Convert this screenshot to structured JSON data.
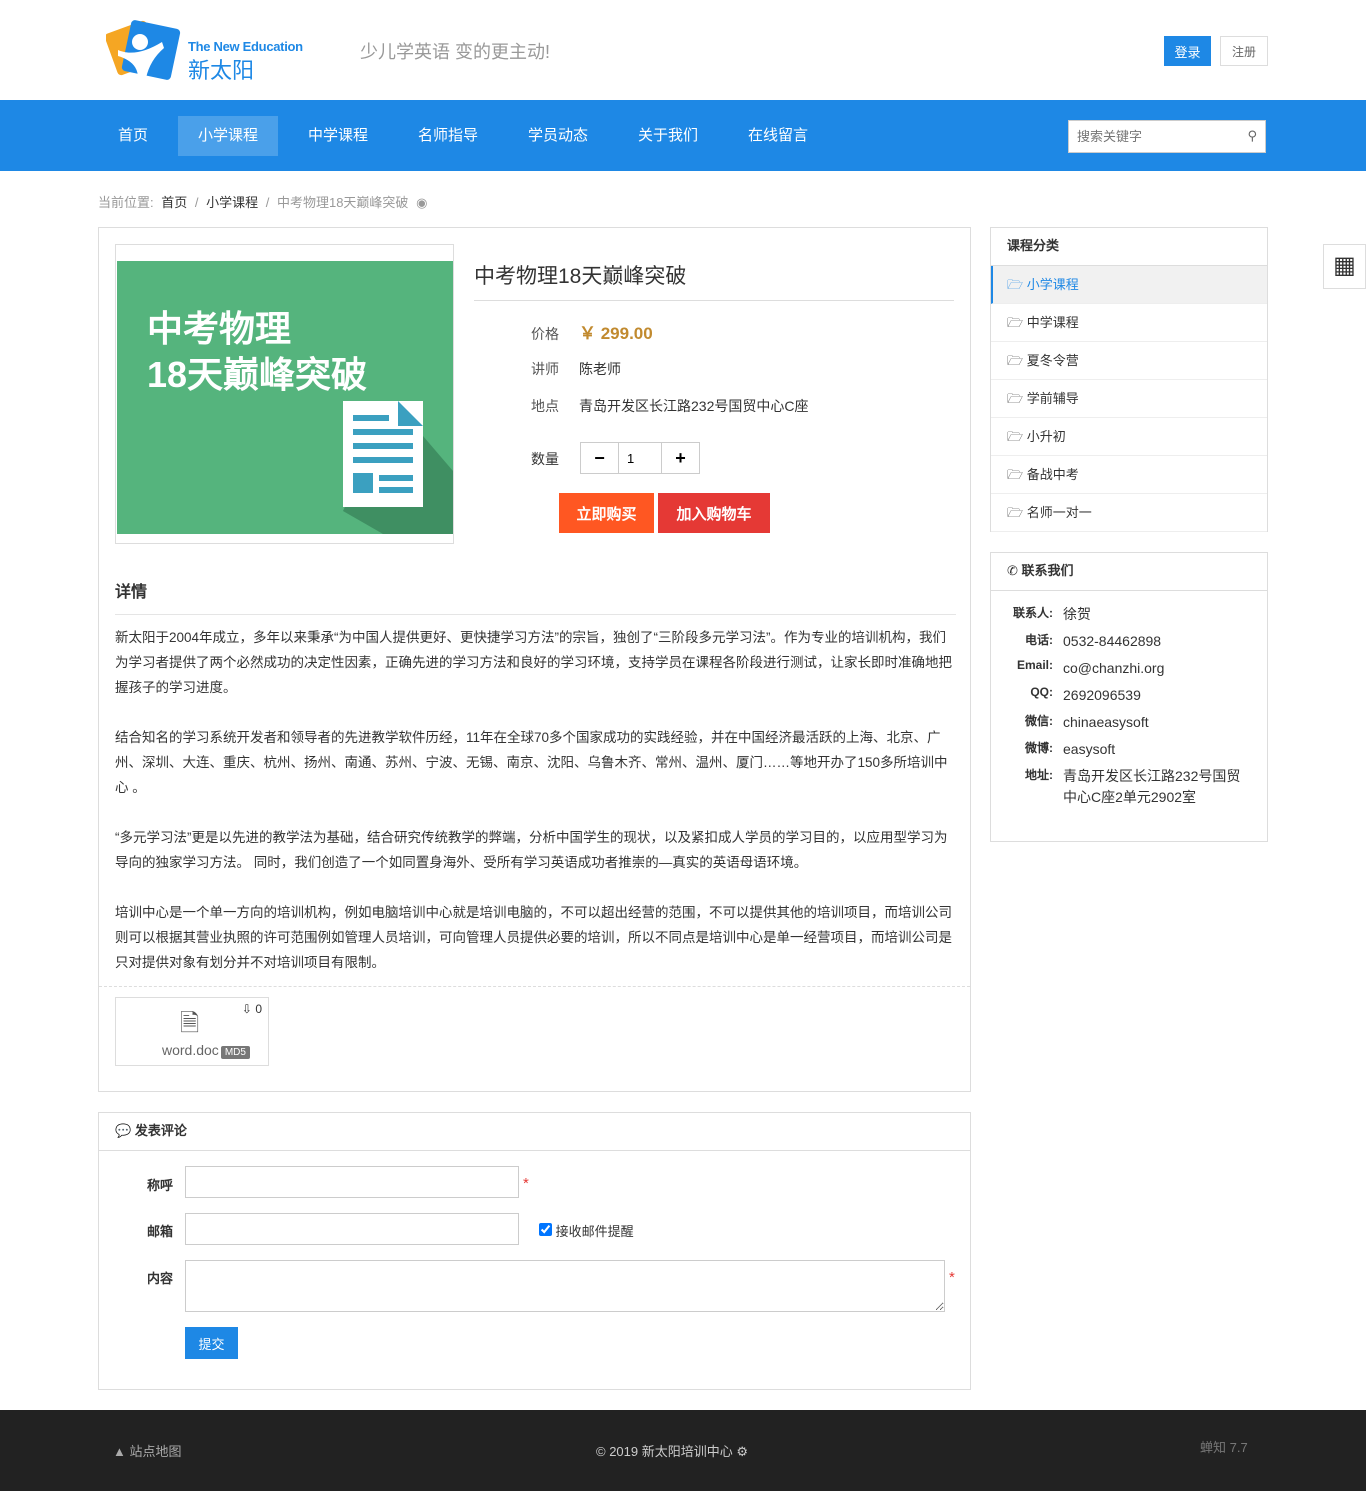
{
  "header": {
    "logo_en": "The New Education",
    "logo_cn": "新太阳",
    "slogan": "少儿学英语 变的更主动!",
    "login": "登录",
    "register": "注册"
  },
  "nav": {
    "items": [
      "首页",
      "小学课程",
      "中学课程",
      "名师指导",
      "学员动态",
      "关于我们",
      "在线留言"
    ],
    "active": 1,
    "search_placeholder": "搜索关键字"
  },
  "breadcrumb": {
    "label": "当前位置:",
    "items": [
      "首页",
      "小学课程",
      "中考物理18天巅峰突破"
    ]
  },
  "product": {
    "image_text1": "中考物理",
    "image_text2": "18天巅峰突破",
    "title": "中考物理18天巅峰突破",
    "price_label": "价格",
    "price": "￥ 299.00",
    "teacher_label": "讲师",
    "teacher": "陈老师",
    "location_label": "地点",
    "location": "青岛开发区长江路232号国贸中心C座",
    "qty_label": "数量",
    "qty": "1",
    "buy": "立即购买",
    "cart": "加入购物车"
  },
  "details": {
    "heading": "详情",
    "paragraphs": [
      "新太阳于2004年成立，多年以来秉承“为中国人提供更好、更快捷学习方法”的宗旨，独创了“三阶段多元学习法”。作为专业的培训机构，我们为学习者提供了两个必然成功的决定性因素，正确先进的学习方法和良好的学习环境，支持学员在课程各阶段进行测试，让家长即时准确地把握孩子的学习进度。",
      "结合知名的学习系统开发者和领导者的先进教学软件历经，11年在全球70多个国家成功的实践经验，并在中国经济最活跃的上海、北京、广州、深圳、大连、重庆、杭州、扬州、南通、苏州、宁波、无锡、南京、沈阳、乌鲁木齐、常州、温州、厦门……等地开办了150多所培训中心 。",
      "“多元学习法”更是以先进的教学法为基础，结合研究传统教学的弊端，分析中国学生的现状，以及紧扣成人学员的学习目的，以应用型学习为导向的独家学习方法。 同时，我们创造了一个如同置身海外、受所有学习英语成功者推崇的—真实的英语母语环境。",
      "培训中心是一个单一方向的培训机构，例如电脑培训中心就是培训电脑的，不可以超出经营的范围，不可以提供其他的培训项目，而培训公司则可以根据其营业执照的许可范围例如管理人员培训，可向管理人员提供必要的培训，所以不同点是培训中心是单一经营项目，而培训公司是只对提供对象有划分并不对培训项目有限制。"
    ]
  },
  "file": {
    "name": "word.doc",
    "badge": "MD5",
    "downloads": "0"
  },
  "categories": {
    "title": "课程分类",
    "items": [
      "小学课程",
      "中学课程",
      "夏冬令营",
      "学前辅导",
      "小升初",
      "备战中考",
      "名师一对一"
    ],
    "active": 0
  },
  "contact": {
    "title": "联系我们",
    "rows": [
      {
        "k": "联系人:",
        "v": "徐贺"
      },
      {
        "k": "电话:",
        "v": "0532-84462898"
      },
      {
        "k": "Email:",
        "v": "co@chanzhi.org"
      },
      {
        "k": "QQ:",
        "v": "2692096539"
      },
      {
        "k": "微信:",
        "v": "chinaeasysoft"
      },
      {
        "k": "微博:",
        "v": "easysoft"
      },
      {
        "k": "地址:",
        "v": "青岛开发区长江路232号国贸中心C座2单元2902室"
      }
    ]
  },
  "comment": {
    "title": "发表评论",
    "name_label": "称呼",
    "email_label": "邮箱",
    "notify": "接收邮件提醒",
    "content_label": "内容",
    "submit": "提交",
    "required": "*"
  },
  "footer": {
    "sitemap": "站点地图",
    "copyright": "© 2019 新太阳培训中心",
    "powered": "蝉知 7.7"
  }
}
